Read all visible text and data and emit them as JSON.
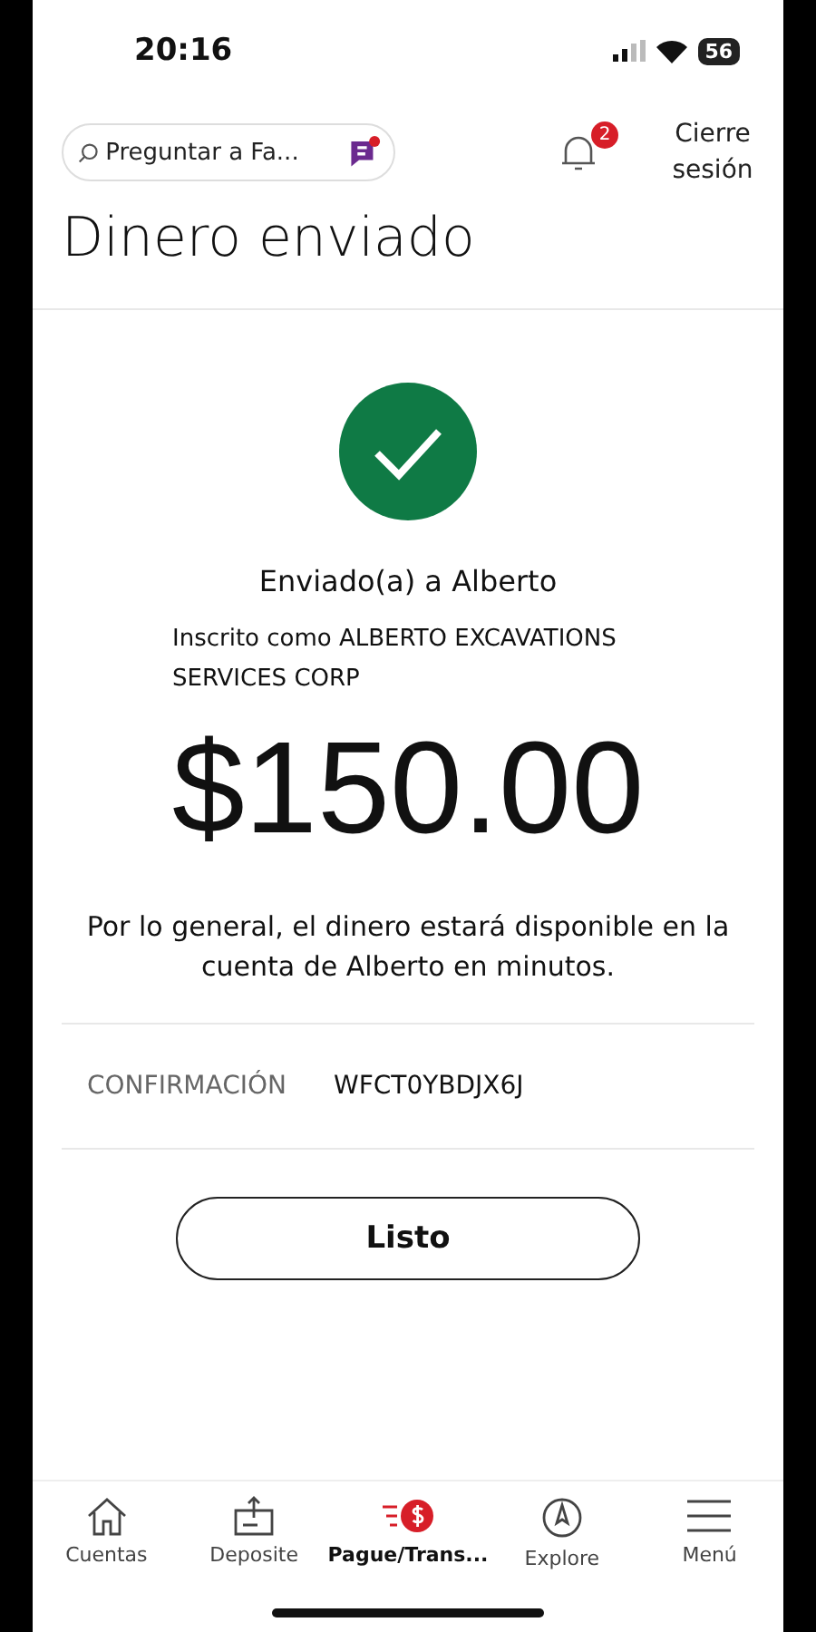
{
  "status_bar": {
    "time": "20:16",
    "battery": "56"
  },
  "header": {
    "search": {
      "placeholder": "Preguntar a Fa..."
    },
    "notifications": {
      "count": "2"
    },
    "logout": "Cierre sesión"
  },
  "title": "Dinero enviado",
  "confirmation": {
    "recipient": "Enviado(a) a Alberto",
    "enrolled_as": "Inscrito como ALBERTO EXCAVATIONS SERVICES CORP",
    "amount": "$150.00",
    "note": "Por lo general, el dinero estará disponible en la cuenta de Alberto en minutos.",
    "label": "CONFIRMACIÓN",
    "code": "WFCT0YBDJX6J"
  },
  "done_button": "Listo",
  "nav": [
    {
      "kind": "house",
      "label": "Cuentas",
      "selected": false
    },
    {
      "kind": "deposit",
      "label": "Deposite",
      "selected": false
    },
    {
      "kind": "pay",
      "label": "Pague/Trans...",
      "selected": true
    },
    {
      "kind": "compass",
      "label": "Explore",
      "selected": false
    },
    {
      "kind": "menu",
      "label": "Menú",
      "selected": false
    }
  ]
}
